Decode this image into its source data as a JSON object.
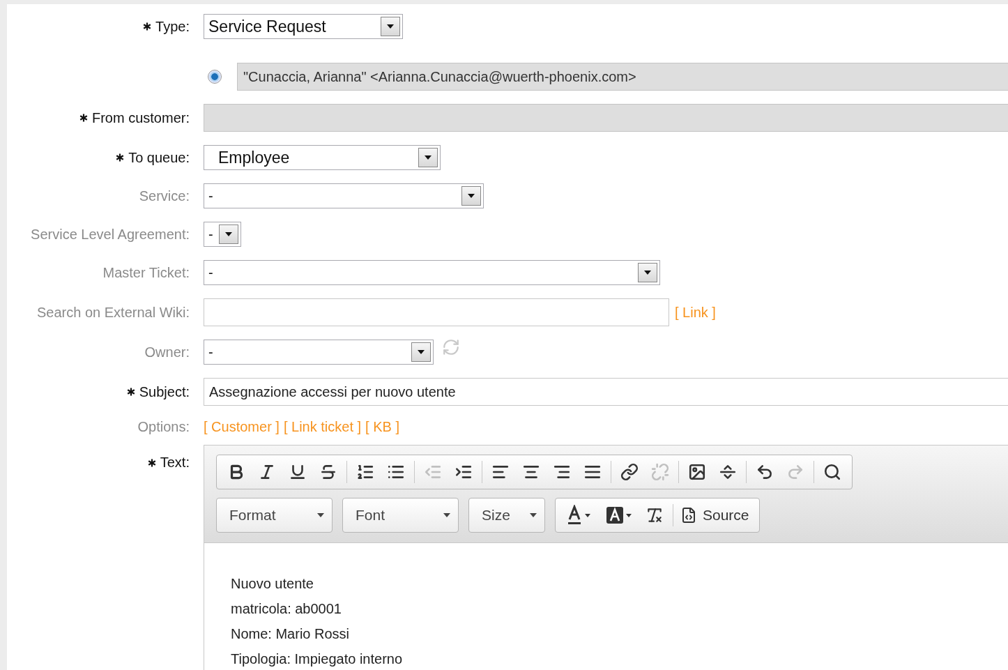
{
  "fields": [
    {
      "kind": "select",
      "label": "Type:",
      "required": true,
      "value": "Service Request"
    },
    {
      "kind": "radio",
      "value": "\"Cunaccia, Arianna\" <Arianna.Cunaccia@wuerth-phoenix.com>",
      "selected": true
    },
    {
      "kind": "readonly",
      "label": "From customer:",
      "required": true
    },
    {
      "kind": "select",
      "label": "To queue:",
      "required": true,
      "value": "Employee"
    },
    {
      "kind": "select",
      "label": "Service:",
      "required": false,
      "value": "-"
    },
    {
      "kind": "select",
      "label": "Service Level Agreement:",
      "required": false,
      "value": "-"
    },
    {
      "kind": "select",
      "label": "Master Ticket:",
      "required": false,
      "value": "-"
    },
    {
      "kind": "search",
      "label": "Search on External Wiki:",
      "required": false,
      "link": "[ Link ]"
    },
    {
      "kind": "owner",
      "label": "Owner:",
      "required": false,
      "value": "-"
    },
    {
      "kind": "text",
      "label": "Subject:",
      "required": true,
      "value": "Assegnazione accessi per nuovo utente"
    },
    {
      "kind": "options",
      "label": "Options:",
      "required": false,
      "links": [
        "[ Customer ]",
        "[ Link ticket ]",
        "[ KB ]"
      ]
    }
  ],
  "editor": {
    "label": "Text:",
    "required": true,
    "toolbar": [
      [
        {
          "kind": "bold",
          "disabled": false
        },
        {
          "kind": "italic",
          "disabled": false
        },
        {
          "kind": "underline",
          "disabled": false
        },
        {
          "kind": "strike",
          "disabled": false
        }
      ],
      [
        {
          "kind": "numbered-list",
          "disabled": false
        },
        {
          "kind": "bullet-list",
          "disabled": false
        }
      ],
      [
        {
          "kind": "outdent",
          "disabled": true
        },
        {
          "kind": "indent",
          "disabled": false
        }
      ],
      [
        {
          "kind": "align-left",
          "disabled": false
        },
        {
          "kind": "align-center",
          "disabled": false
        },
        {
          "kind": "align-right",
          "disabled": false
        },
        {
          "kind": "justify",
          "disabled": false
        }
      ],
      [
        {
          "kind": "link",
          "disabled": false
        },
        {
          "kind": "unlink",
          "disabled": true
        }
      ],
      [
        {
          "kind": "image",
          "disabled": false
        },
        {
          "kind": "rule",
          "disabled": false
        }
      ],
      [
        {
          "kind": "undo",
          "disabled": false
        },
        {
          "kind": "redo",
          "disabled": true
        }
      ],
      [
        {
          "kind": "find",
          "disabled": false
        }
      ]
    ],
    "combos": [
      "Format",
      "Font",
      "Size"
    ],
    "source": "Source",
    "lines": [
      "Nuovo utente",
      "matricola: ab0001",
      "Nome: Mario Rossi",
      "Tipologia: Impiegato interno"
    ]
  }
}
